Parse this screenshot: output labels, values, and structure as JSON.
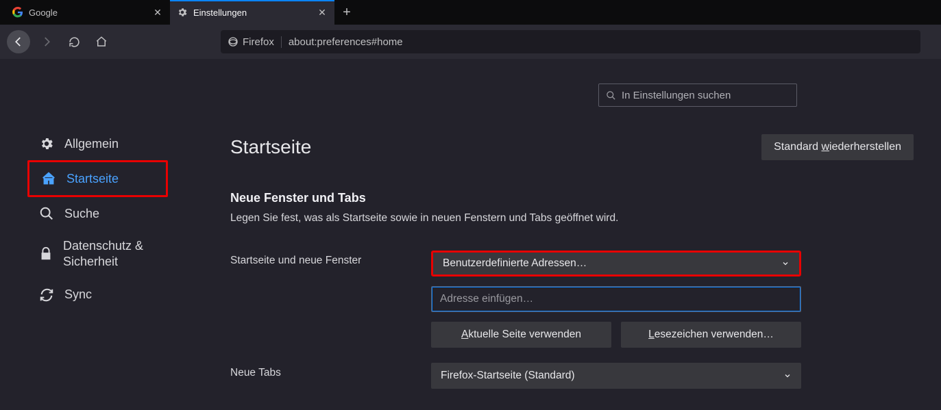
{
  "tabs": [
    {
      "title": "Google"
    },
    {
      "title": "Einstellungen"
    }
  ],
  "urlbar": {
    "identity": "Firefox",
    "url": "about:preferences#home"
  },
  "prefs_search": {
    "placeholder": "In Einstellungen suchen"
  },
  "sidebar": {
    "general": "Allgemein",
    "home": "Startseite",
    "search": "Suche",
    "privacy": "Datenschutz & Sicherheit",
    "sync": "Sync"
  },
  "main": {
    "title": "Startseite",
    "restore_pre": "Standard ",
    "restore_ak": "w",
    "restore_post": "iederherstellen",
    "section_title": "Neue Fenster und Tabs",
    "section_desc": "Legen Sie fest, was als Startseite sowie in neuen Fenstern und Tabs geöffnet wird.",
    "row1_label": "Startseite und neue Fenster",
    "row1_select_value": "Benutzerdefinierte Adressen…",
    "row1_input_placeholder": "Adresse einfügen…",
    "btn_current_ak": "A",
    "btn_current_post": "ktuelle Seite verwenden",
    "btn_bookmark_ak": "L",
    "btn_bookmark_post": "esezeichen verwenden…",
    "row2_label": "Neue Tabs",
    "row2_select_value": "Firefox-Startseite (Standard)"
  }
}
